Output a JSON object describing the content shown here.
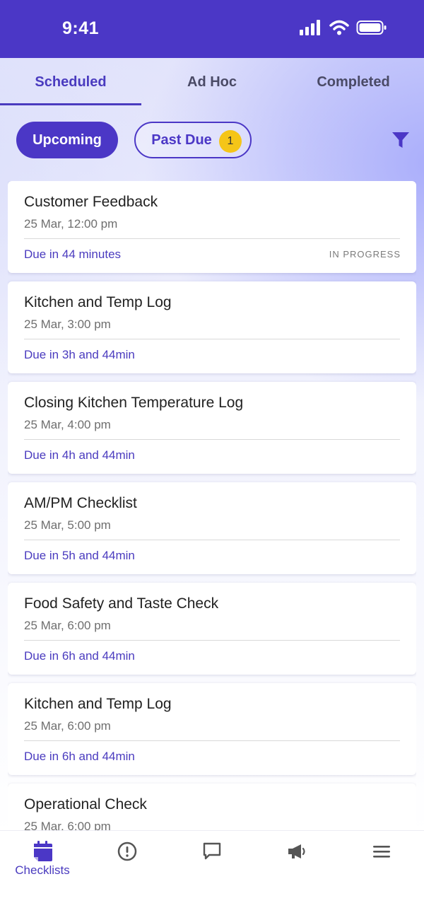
{
  "status_bar": {
    "time": "9:41"
  },
  "tabs": [
    {
      "label": "Scheduled",
      "active": true
    },
    {
      "label": "Ad Hoc",
      "active": false
    },
    {
      "label": "Completed",
      "active": false
    }
  ],
  "filters": {
    "upcoming_label": "Upcoming",
    "past_due_label": "Past Due",
    "past_due_count": "1"
  },
  "checklists": [
    {
      "title": "Customer Feedback",
      "date": "25 Mar, 12:00 pm",
      "due": "Due in 44 minutes",
      "status": "IN PROGRESS"
    },
    {
      "title": "Kitchen and Temp Log",
      "date": "25 Mar, 3:00 pm",
      "due": "Due in 3h and 44min",
      "status": ""
    },
    {
      "title": "Closing Kitchen Temperature Log",
      "date": "25 Mar, 4:00 pm",
      "due": "Due in 4h and 44min",
      "status": ""
    },
    {
      "title": "AM/PM Checklist",
      "date": "25 Mar, 5:00 pm",
      "due": "Due in 5h and 44min",
      "status": ""
    },
    {
      "title": "Food Safety and Taste Check",
      "date": "25 Mar, 6:00 pm",
      "due": "Due in 6h and 44min",
      "status": ""
    },
    {
      "title": "Kitchen and Temp Log",
      "date": "25 Mar, 6:00 pm",
      "due": "Due in 6h and 44min",
      "status": ""
    },
    {
      "title": "Operational Check",
      "date": "25 Mar, 6:00 pm",
      "due": "",
      "status": ""
    }
  ],
  "bottom_nav": [
    {
      "label": "Checklists",
      "icon": "calendar-icon",
      "active": true
    },
    {
      "label": "",
      "icon": "alert-circle-icon",
      "active": false
    },
    {
      "label": "",
      "icon": "chat-icon",
      "active": false
    },
    {
      "label": "",
      "icon": "megaphone-icon",
      "active": false
    },
    {
      "label": "",
      "icon": "menu-icon",
      "active": false
    }
  ],
  "colors": {
    "primary": "#4b37c6",
    "accent_text": "#4a3bbf",
    "badge": "#f5c518"
  }
}
